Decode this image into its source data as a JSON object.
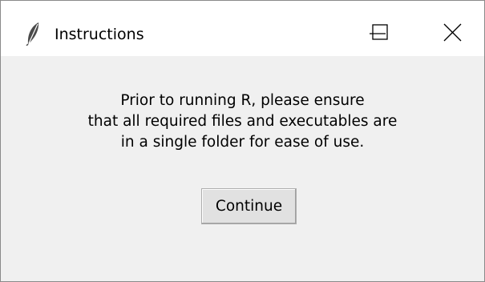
{
  "window": {
    "title": "Instructions",
    "app_icon": "feather-icon",
    "controls": {
      "minimize_icon": "minimize-icon",
      "maximize_icon": "maximize-icon",
      "close_icon": "close-icon"
    }
  },
  "dialog": {
    "message_lines": [
      "Prior to running R, please ensure",
      "that all required files and executables are",
      "in a single folder for ease of use."
    ],
    "continue_label": "Continue"
  }
}
